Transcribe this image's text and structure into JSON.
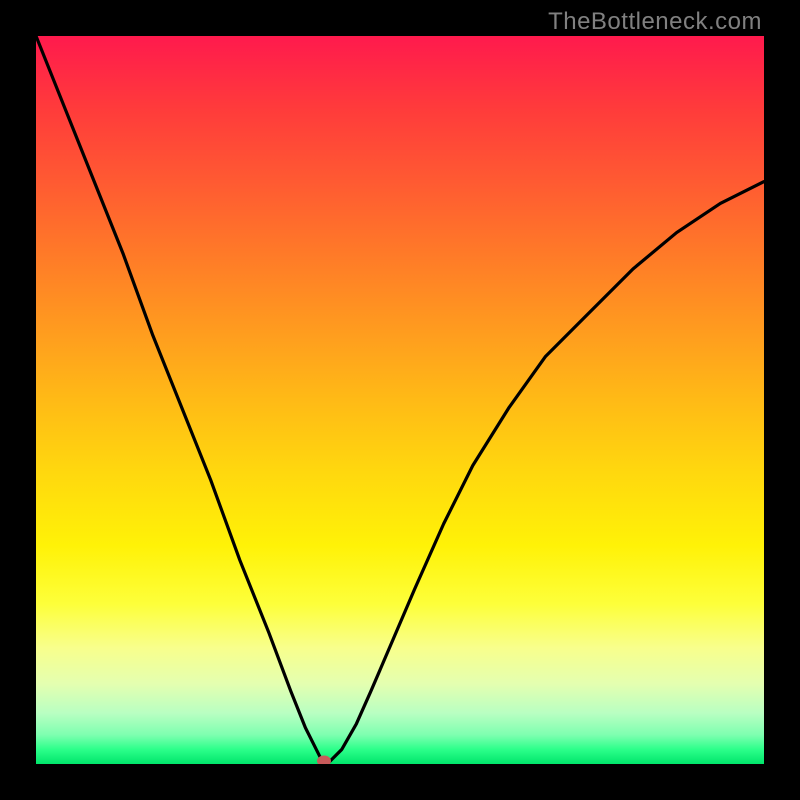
{
  "watermark": "TheBottleneck.com",
  "chart_data": {
    "type": "line",
    "title": "",
    "xlabel": "",
    "ylabel": "",
    "xlim": [
      0,
      1
    ],
    "ylim": [
      0,
      1
    ],
    "series": [
      {
        "name": "curve",
        "x": [
          0.0,
          0.04,
          0.08,
          0.12,
          0.16,
          0.2,
          0.24,
          0.28,
          0.32,
          0.35,
          0.37,
          0.385,
          0.39,
          0.395,
          0.4,
          0.405,
          0.42,
          0.44,
          0.46,
          0.49,
          0.52,
          0.56,
          0.6,
          0.65,
          0.7,
          0.76,
          0.82,
          0.88,
          0.94,
          1.0
        ],
        "y": [
          1.0,
          0.9,
          0.8,
          0.7,
          0.59,
          0.49,
          0.39,
          0.28,
          0.18,
          0.1,
          0.05,
          0.02,
          0.01,
          0.005,
          0.0,
          0.005,
          0.02,
          0.055,
          0.1,
          0.17,
          0.24,
          0.33,
          0.41,
          0.49,
          0.56,
          0.62,
          0.68,
          0.73,
          0.77,
          0.8
        ]
      }
    ],
    "marker": {
      "x": 0.395,
      "y": 0.0,
      "color": "#c85a5a"
    },
    "background_gradient": {
      "top": "#ff1a4d",
      "bottom": "#00e56b",
      "stops": [
        "red",
        "orange",
        "yellow",
        "green"
      ]
    }
  },
  "colors": {
    "frame": "#000000",
    "curve_stroke": "#000000",
    "watermark": "#808080",
    "marker": "#c85a5a"
  }
}
